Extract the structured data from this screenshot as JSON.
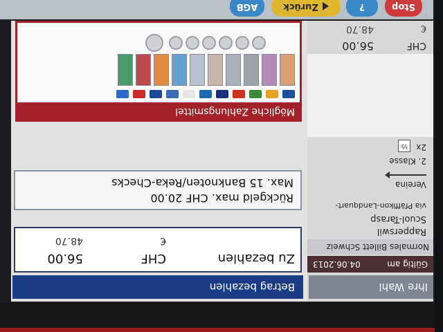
{
  "toolbar": {
    "agb_label": "AGB",
    "zurueck_label": "Zurück",
    "help_label": "?",
    "stop_label": "Stop"
  },
  "wahl": {
    "header": "Ihre Wahl",
    "valid_label": "Gültig am",
    "valid_date": "04.06.2013",
    "ticket_name": "Normales Billett Schweiz",
    "route_from": "Rapperswil",
    "route_to": "Scuol-Tarasp",
    "route_via": "via Pfäffikon-Landquart-",
    "route_end": "Vereina",
    "class_text": "2. Klasse",
    "pass_count": "2x",
    "half_symbol": "½",
    "sum_chf_label": "CHF",
    "sum_chf_value": "56.00",
    "sum_eur_label": "€",
    "sum_eur_value": "48.70"
  },
  "payment": {
    "header": "Betrag bezahlen",
    "due_label": "Zu bezahlen",
    "due_chf_label": "CHF",
    "due_chf_value": "56.00",
    "due_eur_label": "€",
    "due_eur_value": "48.70",
    "change_line1": "Rückgeld max. CHF 20.00",
    "change_line2": "Max. 15 Banknoten/Reka-Checks",
    "methods_header": "Mögliche Zahlungsmittel"
  },
  "colors": {
    "pay_header": "#1a3c87",
    "methods_red": "#a32128",
    "wahl_header": "#7d8691",
    "zurueck_button": "#e0b830",
    "stop_button": "#cc3a3a",
    "help_button": "#3a87c8"
  }
}
